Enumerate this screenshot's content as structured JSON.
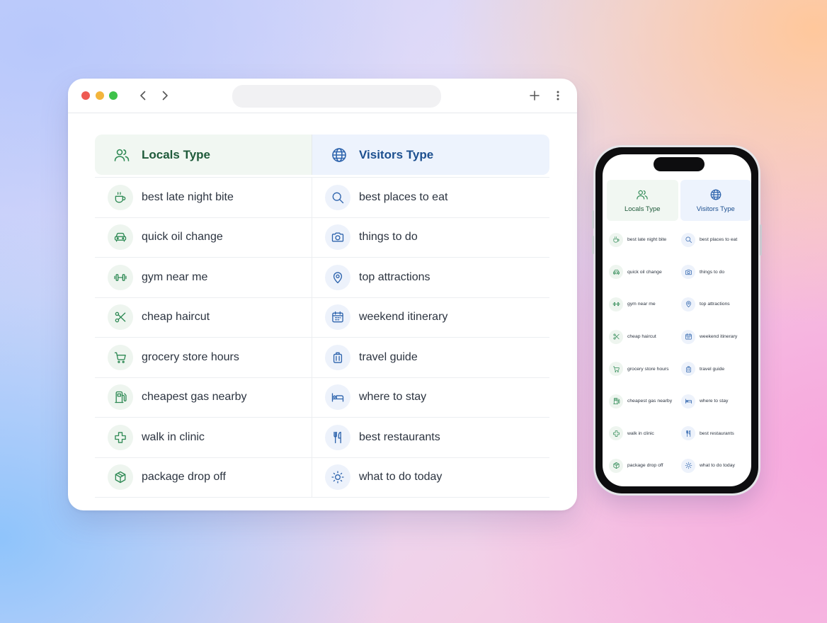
{
  "browser": {
    "address": ""
  },
  "colors": {
    "locals_accent": "#2f8a55",
    "visitors_accent": "#2e64ad",
    "locals_header_bg": "#f1f7f2",
    "visitors_header_bg": "#edf3fd"
  },
  "table": {
    "locals_header": {
      "label": "Locals Type",
      "icon": "users-icon"
    },
    "visitors_header": {
      "label": "Visitors Type",
      "icon": "globe-icon"
    },
    "rows": [
      {
        "local": {
          "label": "best late night bite",
          "icon": "coffee-cup-icon"
        },
        "visitor": {
          "label": "best places to eat",
          "icon": "search-icon"
        }
      },
      {
        "local": {
          "label": "quick oil change",
          "icon": "car-icon"
        },
        "visitor": {
          "label": "things to do",
          "icon": "camera-icon"
        }
      },
      {
        "local": {
          "label": "gym near me",
          "icon": "dumbbell-icon"
        },
        "visitor": {
          "label": "top attractions",
          "icon": "map-pin-icon"
        }
      },
      {
        "local": {
          "label": "cheap haircut",
          "icon": "scissors-icon"
        },
        "visitor": {
          "label": "weekend itinerary",
          "icon": "calendar-icon"
        }
      },
      {
        "local": {
          "label": "grocery store hours",
          "icon": "shopping-cart-icon"
        },
        "visitor": {
          "label": "travel guide",
          "icon": "luggage-icon"
        }
      },
      {
        "local": {
          "label": "cheapest gas nearby",
          "icon": "fuel-pump-icon"
        },
        "visitor": {
          "label": "where to stay",
          "icon": "bed-icon"
        }
      },
      {
        "local": {
          "label": "walk in clinic",
          "icon": "medical-cross-icon"
        },
        "visitor": {
          "label": "best restaurants",
          "icon": "utensils-icon"
        }
      },
      {
        "local": {
          "label": "package drop off",
          "icon": "package-icon"
        },
        "visitor": {
          "label": "what to do today",
          "icon": "sun-icon"
        }
      }
    ]
  }
}
